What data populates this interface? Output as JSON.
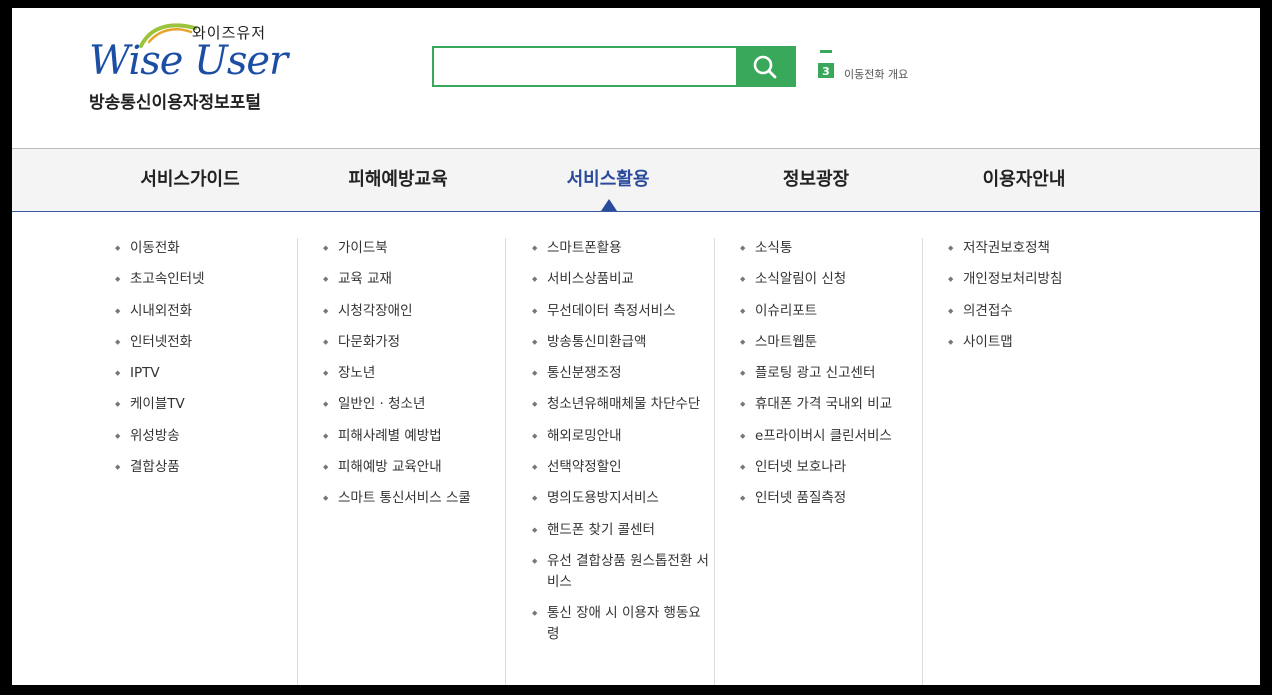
{
  "header": {
    "logo_korean": "와이즈유저",
    "logo_english": "Wise User",
    "logo_subtitle": "방송통신이용자정보포털",
    "search": {
      "value": "",
      "placeholder": ""
    },
    "ticker": {
      "icon_number": "3",
      "text": "이동전화 개요"
    }
  },
  "colors": {
    "brand_green": "#3aa85a",
    "brand_blue": "#2a4a9c"
  },
  "nav": {
    "items": [
      {
        "label": "서비스가이드"
      },
      {
        "label": "피해예방교육"
      },
      {
        "label": "서비스활용",
        "active": true
      },
      {
        "label": "정보광장"
      },
      {
        "label": "이용자안내"
      }
    ]
  },
  "menu": {
    "col1": [
      "이동전화",
      "초고속인터넷",
      "시내외전화",
      "인터넷전화",
      "IPTV",
      "케이블TV",
      "위성방송",
      "결합상품"
    ],
    "col2": [
      "가이드북",
      "교육 교재",
      "시청각장애인",
      "다문화가정",
      "장노년",
      "일반인 · 청소년",
      "피해사례별 예방법",
      "피해예방 교육안내",
      "스마트 통신서비스 스쿨"
    ],
    "col3": [
      "스마트폰활용",
      "서비스상품비교",
      "무선데이터 측정서비스",
      "방송통신미환급액",
      "통신분쟁조정",
      "청소년유해매체물 차단수단",
      "해외로밍안내",
      "선택약정할인",
      "명의도용방지서비스",
      "핸드폰 찾기 콜센터",
      "유선 결합상품 원스톱전환 서비스",
      "통신 장애 시 이용자 행동요령"
    ],
    "col4": [
      "소식통",
      "소식알림이 신청",
      "이슈리포트",
      "스마트웹툰",
      "플로팅 광고 신고센터",
      "휴대폰 가격 국내외 비교",
      "e프라이버시 클린서비스",
      "인터넷 보호나라",
      "인터넷 품질측정"
    ],
    "col5": [
      "저작권보호정책",
      "개인정보처리방침",
      "의견접수",
      "사이트맵"
    ]
  }
}
